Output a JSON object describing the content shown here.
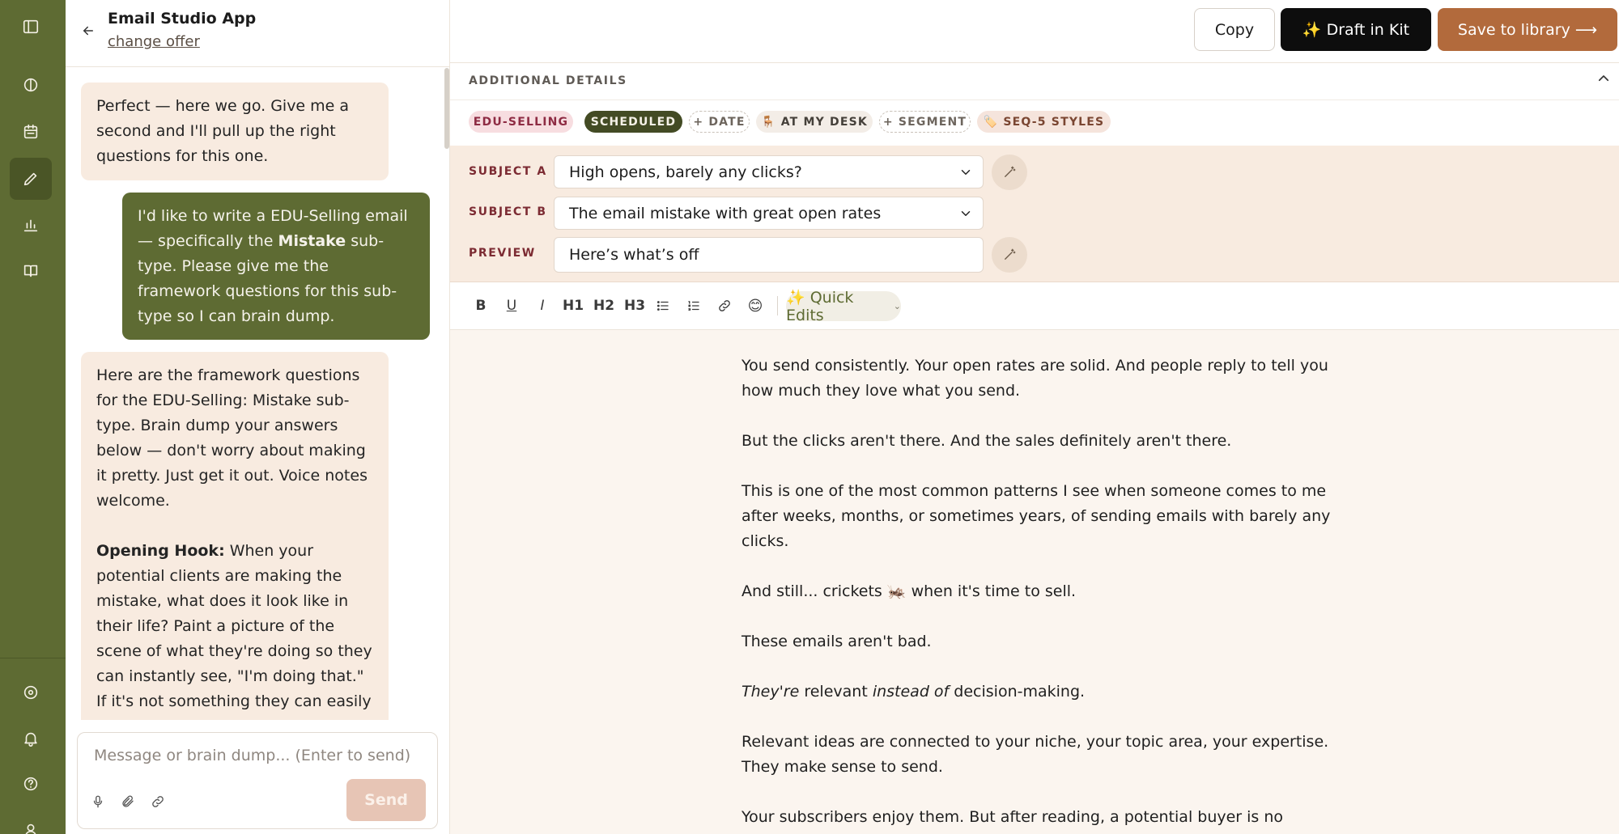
{
  "app": {
    "title": "Email Studio App",
    "change_offer": "change offer"
  },
  "rail": {
    "icons": [
      "sidebar-toggle-icon",
      "half-circle-icon",
      "calendar-icon",
      "pencil-icon",
      "bar-chart-icon",
      "book-icon",
      "settings-icon",
      "bell-icon",
      "help-icon",
      "user-icon"
    ],
    "active": "pencil-icon"
  },
  "chat": {
    "messages": [
      {
        "role": "assistant",
        "text": "Perfect — here we go. Give me a second and I'll pull up the right questions for this one."
      },
      {
        "role": "user",
        "text_before": "I'd like to write a EDU-Selling email — specifically the ",
        "bold": "Mistake",
        "text_after": " sub-type. Please give me the framework questions for this sub-type so I can brain dump."
      },
      {
        "role": "assistant",
        "text": "Here are the framework questions for the EDU-Selling: Mistake sub-type. Brain dump your answers below — don't worry about making it pretty. Just get it out. Voice notes welcome.",
        "bold2": "Opening Hook:",
        "text2": " When your potential clients are making the mistake, what does it look like in their life? Paint a picture of the scene of what they're doing so they can instantly see, \"I'm doing that.\" If it's not something they can easily recognize"
      }
    ],
    "composer_placeholder": "Message or brain dump... (Enter to send)",
    "send_label": "Send"
  },
  "topbar": {
    "copy_label": "Copy",
    "draft_label": "✨ Draft in Kit",
    "save_label": "Save to library ⟶"
  },
  "details": {
    "label": "ADDITIONAL DETAILS",
    "tags": {
      "edu": "EDU-SELLING",
      "scheduled": "SCHEDULED",
      "date": "+ DATE",
      "desk": "🪑 AT MY DESK",
      "segment": "+ SEGMENT",
      "seq": "🏷️ SEQ-5 STYLES"
    }
  },
  "subjects": {
    "a_label": "SUBJECT A",
    "a_value": "High opens, barely any clicks?",
    "b_label": "SUBJECT B",
    "b_value": "The email mistake with great open rates",
    "preview_label": "PREVIEW",
    "preview_value": "Here’s what’s off"
  },
  "toolbar": {
    "bold": "B",
    "underline": "U",
    "italic": "I",
    "h1": "H1",
    "h2": "H2",
    "h3": "H3",
    "emoji": "😊",
    "quick_edits": "✨ Quick Edits"
  },
  "email_body": {
    "p1": "You send consistently. Your open rates are solid. And people reply to tell you how much they love what you send.",
    "p2": "But the clicks aren't there. And the sales definitely aren't there.",
    "p3": "This is one of the most common patterns I see when someone comes to me after weeks, months, or sometimes years, of sending emails with barely any clicks.",
    "p4": "And still... crickets 🦗 when it's time to sell.",
    "p5": "These emails aren't bad.",
    "p6a": "They're",
    "p6b": " relevant ",
    "p6c": "instead of",
    "p6d": " decision-making.",
    "p7": "Relevant ideas are connected to your niche, your topic area, your expertise. They make sense to send.",
    "p8": "Your subscribers enjoy them. But after reading, a potential buyer is no further"
  }
}
